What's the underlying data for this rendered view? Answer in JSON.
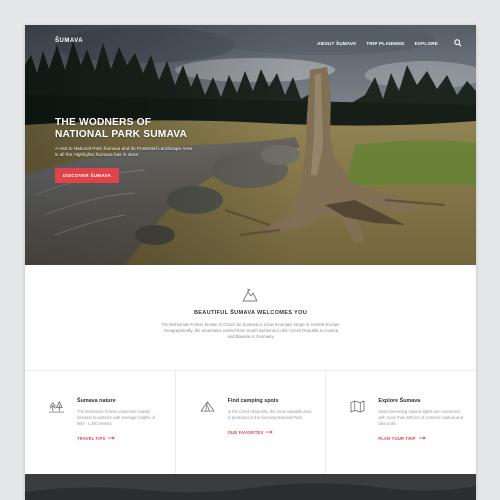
{
  "nav": {
    "logo": "ŠUMAVA",
    "links": [
      "ABOUT ŠUMAVA",
      "TRIP PLANNING",
      "EXPLORE"
    ]
  },
  "hero": {
    "title_line1": "THE WODNERS OF",
    "title_line2": "NATIONAL PARK SUMAVA",
    "subtitle": "A visit to National Park Šumava and its Protected Landscape Area is all the Highlights Šumava has in store.",
    "button": "DISCOVER ŠUMAVA"
  },
  "welcome": {
    "icon": "hiking-icon",
    "title": "BEAUTIFUL ŠUMAVA WELCOMES YOU",
    "text": "The Bohemian Forest, known in Czech as Šumava is a low mountain range in Central Europe. Geographically, the mountains extend from South Bohemia in the Czech Republic to Austria and Bavaria in Germany."
  },
  "features": [
    {
      "icon": "tree-icon",
      "title": "Šumava nature",
      "text": "The Bohemian Forest comprises heavily forested mountains with average heights of 800 - 1,400 meters.",
      "link": "TRAVEL TIPS"
    },
    {
      "icon": "tent-icon",
      "title": "Find camping spots",
      "text": "In the Czech Republic, the most valuable area is protected in the Šumava National Park.",
      "link": "OUR FAVORITES"
    },
    {
      "icon": "map-icon",
      "title": "Explore Šumava",
      "text": "Most interesting natural sights are connected with more than 500 km of summer marked and bike trails.",
      "link": "PLAN YOUR TRIP"
    }
  ],
  "colors": {
    "accent": "#e2424a",
    "page_bg": "#e6e7e9",
    "dark_strip": "#3b3c3e"
  }
}
